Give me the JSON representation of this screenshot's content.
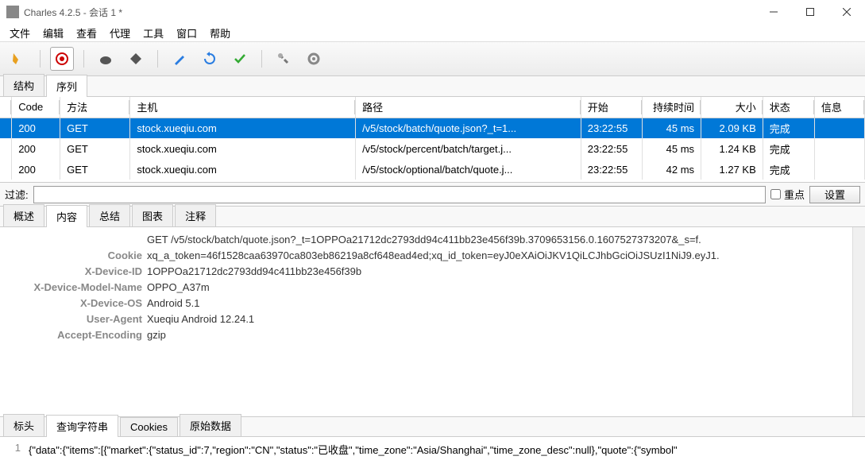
{
  "window": {
    "title": "Charles 4.2.5 - 会话 1 *"
  },
  "menu": [
    "文件",
    "编辑",
    "查看",
    "代理",
    "工具",
    "窗口",
    "帮助"
  ],
  "mainTabs": {
    "tab1": "结构",
    "tab2": "序列"
  },
  "columns": {
    "code": "Code",
    "method": "方法",
    "host": "主机",
    "path": "路径",
    "start": "开始",
    "duration": "持续时间",
    "size": "大小",
    "status": "状态",
    "info": "信息"
  },
  "rows": [
    {
      "code": "200",
      "method": "GET",
      "host": "stock.xueqiu.com",
      "path": "/v5/stock/batch/quote.json?_t=1...",
      "start": "23:22:55",
      "duration": "45 ms",
      "size": "2.09 KB",
      "status": "完成",
      "info": "",
      "selected": true
    },
    {
      "code": "200",
      "method": "GET",
      "host": "stock.xueqiu.com",
      "path": "/v5/stock/percent/batch/target.j...",
      "start": "23:22:55",
      "duration": "45 ms",
      "size": "1.24 KB",
      "status": "完成",
      "info": "",
      "selected": false
    },
    {
      "code": "200",
      "method": "GET",
      "host": "stock.xueqiu.com",
      "path": "/v5/stock/optional/batch/quote.j...",
      "start": "23:22:55",
      "duration": "42 ms",
      "size": "1.27 KB",
      "status": "完成",
      "info": "",
      "selected": false
    }
  ],
  "filter": {
    "label": "过滤:",
    "value": "",
    "focus_label": "重点",
    "settings_label": "设置"
  },
  "detailTabs": {
    "overview": "概述",
    "content": "内容",
    "summary": "总结",
    "chart": "图表",
    "notes": "注释"
  },
  "request_line": "GET /v5/stock/batch/quote.json?_t=1OPPOa21712dc2793dd94c411bb23e456f39b.3709653156.0.1607527373207&_s=f.",
  "headers": [
    {
      "key": "Cookie",
      "val": "xq_a_token=46f1528caa63970ca803eb86219a8cf648ead4ed;xq_id_token=eyJ0eXAiOiJKV1QiLCJhbGciOiJSUzI1NiJ9.eyJ1."
    },
    {
      "key": "X-Device-ID",
      "val": "1OPPOa21712dc2793dd94c411bb23e456f39b"
    },
    {
      "key": "X-Device-Model-Name",
      "val": "OPPO_A37m"
    },
    {
      "key": "X-Device-OS",
      "val": "Android 5.1"
    },
    {
      "key": "User-Agent",
      "val": "Xueqiu Android 12.24.1"
    },
    {
      "key": "Accept-Encoding",
      "val": "gzip"
    }
  ],
  "bottomTabs": {
    "headers": "标头",
    "query": "查询字符串",
    "cookies": "Cookies",
    "raw": "原始数据"
  },
  "response_body": "{\"data\":{\"items\":[{\"market\":{\"status_id\":7,\"region\":\"CN\",\"status\":\"已收盘\",\"time_zone\":\"Asia/Shanghai\",\"time_zone_desc\":null},\"quote\":{\"symbol\""
}
